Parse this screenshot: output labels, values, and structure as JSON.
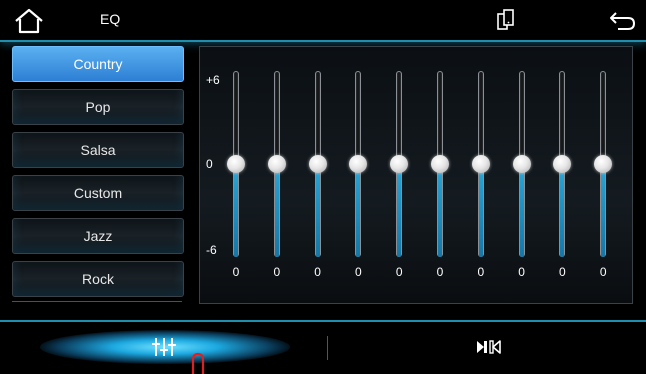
{
  "header": {
    "title": "EQ",
    "icons": {
      "home": "home-icon",
      "phone": "phone-link-icon",
      "back": "back-arrow-icon"
    }
  },
  "presets": [
    {
      "label": "Country",
      "active": true
    },
    {
      "label": "Pop",
      "active": false
    },
    {
      "label": "Salsa",
      "active": false
    },
    {
      "label": "Custom",
      "active": false
    },
    {
      "label": "Jazz",
      "active": false
    },
    {
      "label": "Rock",
      "active": false
    }
  ],
  "eq": {
    "scale_max": "+6",
    "scale_mid": "0",
    "scale_min": "-6",
    "bands": [
      {
        "value": "0",
        "level": 0
      },
      {
        "value": "0",
        "level": 0
      },
      {
        "value": "0",
        "level": 0
      },
      {
        "value": "0",
        "level": 0
      },
      {
        "value": "0",
        "level": 0
      },
      {
        "value": "0",
        "level": 0
      },
      {
        "value": "0",
        "level": 0
      },
      {
        "value": "0",
        "level": 0
      },
      {
        "value": "0",
        "level": 0
      },
      {
        "value": "0",
        "level": 0
      }
    ]
  },
  "bottom_tabs": [
    {
      "icon": "equalizer-icon",
      "active": true
    },
    {
      "icon": "speaker-fader-icon",
      "active": false
    }
  ],
  "colors": {
    "accent": "#1f8fb0",
    "active_preset": "#2d7fd4",
    "slider_fill": "#1c95c8"
  }
}
